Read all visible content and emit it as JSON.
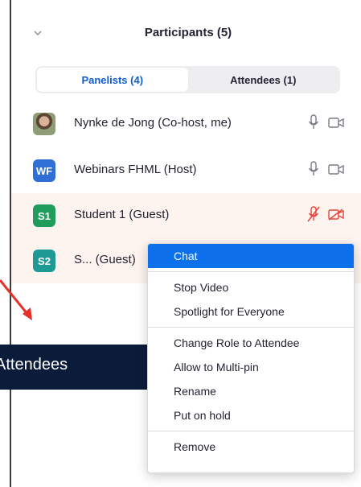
{
  "header": {
    "title": "Participants (5)",
    "collapse_icon": "chevron-down-icon"
  },
  "tabs": [
    {
      "label": "Panelists (4)",
      "active": true
    },
    {
      "label": "Attendees (1)",
      "active": false
    }
  ],
  "participants": [
    {
      "avatar_type": "photo",
      "avatar_text": "",
      "avatar_color": "",
      "name": "Nynke de Jong (Co-host, me)",
      "mic": "on",
      "video": "on",
      "highlighted": false
    },
    {
      "avatar_type": "initials",
      "avatar_text": "WF",
      "avatar_color": "#2f6fd6",
      "name": "Webinars FHML (Host)",
      "mic": "on",
      "video": "on",
      "highlighted": false
    },
    {
      "avatar_type": "initials",
      "avatar_text": "S1",
      "avatar_color": "#1f9d5c",
      "name": "Student 1 (Guest)",
      "mic": "muted",
      "video": "off",
      "highlighted": true
    },
    {
      "avatar_type": "initials",
      "avatar_text": "S2",
      "avatar_color": "#1d9a94",
      "name": "S... (Guest)",
      "mic": "",
      "video": "",
      "highlighted": true
    }
  ],
  "context_menu": {
    "groups": [
      [
        "Chat"
      ],
      [
        "Stop Video",
        "Spotlight for Everyone"
      ],
      [
        "Change Role to Attendee",
        "Allow to Multi-pin",
        "Rename",
        "Put on hold"
      ],
      [
        "Remove"
      ]
    ],
    "selected": "Chat"
  },
  "callout": {
    "text": "Attendees"
  },
  "colors": {
    "accent_blue": "#0e71eb",
    "tab_active_text": "#0e5fcc",
    "muted_red": "#e8453c",
    "row_highlight": "#fdf3ef",
    "callout_bg": "#0b1b3a",
    "arrow_red": "#e8302a"
  }
}
